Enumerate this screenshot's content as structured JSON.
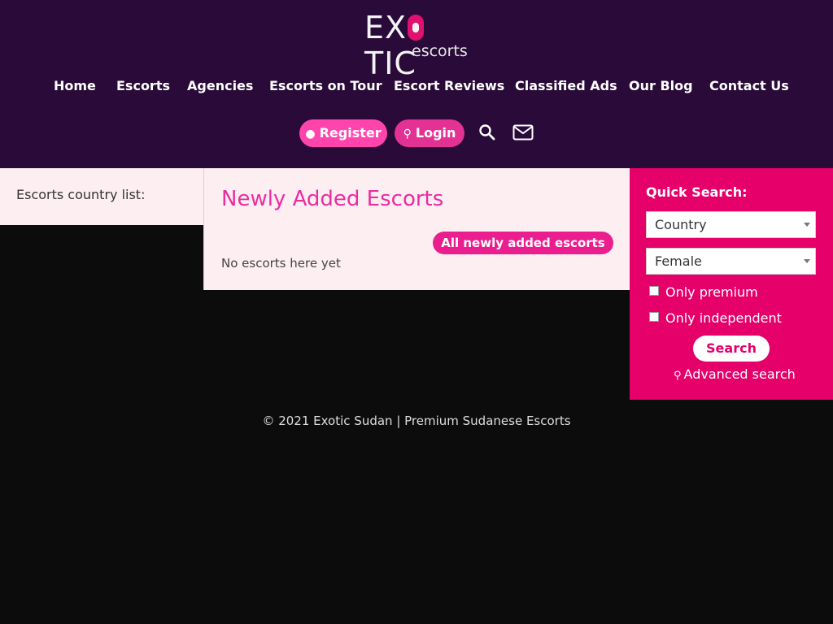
{
  "logo": {
    "main_left": "EX",
    "main_right": "TIC",
    "sub": "escorts"
  },
  "nav": {
    "items": [
      {
        "label": "Home"
      },
      {
        "label": "Escorts"
      },
      {
        "label": "Agencies"
      },
      {
        "label": "Escorts on Tour"
      },
      {
        "label": "Escort Reviews"
      },
      {
        "label": "Classified Ads"
      },
      {
        "label": "Our Blog"
      },
      {
        "label": "Contact Us"
      }
    ]
  },
  "header_buttons": {
    "register": "Register",
    "login": "Login",
    "search_icon": "search-icon",
    "mail_icon": "mail-icon"
  },
  "left_panel": {
    "title": "Escorts country list:"
  },
  "center_panel": {
    "title": "Newly Added Escorts",
    "all_button": "All newly added escorts",
    "empty_text": "No escorts here yet"
  },
  "quick_search": {
    "title": "Quick Search:",
    "country_value": "Country",
    "gender_value": "Female",
    "only_premium": "Only premium",
    "only_independent": "Only independent",
    "search_button": "Search",
    "advanced_search": "Advanced search"
  },
  "footer": {
    "text": "© 2021 Exotic Sudan | Premium Sudanese Escorts"
  },
  "colors": {
    "header_bg": "#290a38",
    "accent_pink": "#e5006a",
    "title_pink": "#ea2d9f",
    "panel_bg": "#fdeef2",
    "page_bg": "#0d0c0d"
  }
}
